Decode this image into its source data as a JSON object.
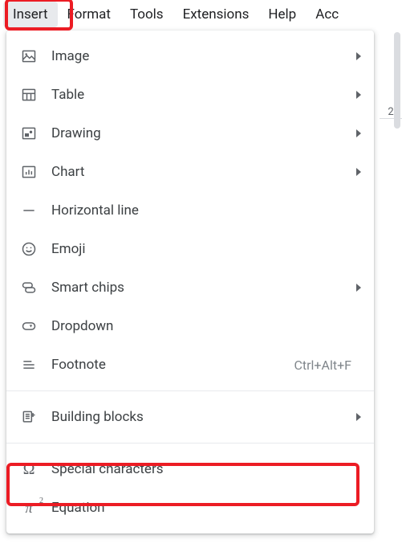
{
  "menubar": {
    "items": [
      "Insert",
      "Format",
      "Tools",
      "Extensions",
      "Help",
      "Acc"
    ]
  },
  "dropdown": {
    "groups": [
      [
        {
          "icon": "image-icon",
          "label": "Image",
          "submenu": true
        },
        {
          "icon": "table-icon",
          "label": "Table",
          "submenu": true
        },
        {
          "icon": "drawing-icon",
          "label": "Drawing",
          "submenu": true
        },
        {
          "icon": "chart-icon",
          "label": "Chart",
          "submenu": true
        },
        {
          "icon": "horizontal-line-icon",
          "label": "Horizontal line"
        },
        {
          "icon": "emoji-icon",
          "label": "Emoji"
        },
        {
          "icon": "smart-chips-icon",
          "label": "Smart chips",
          "submenu": true
        },
        {
          "icon": "dropdown-icon",
          "label": "Dropdown"
        },
        {
          "icon": "footnote-icon",
          "label": "Footnote",
          "shortcut": "Ctrl+Alt+F"
        }
      ],
      [
        {
          "icon": "building-blocks-icon",
          "label": "Building blocks",
          "submenu": true
        }
      ],
      [
        {
          "icon": "omega-icon",
          "label": "Special characters"
        },
        {
          "icon": "equation-icon",
          "label": "Equation"
        }
      ]
    ]
  },
  "ruler": {
    "mark": "2"
  }
}
